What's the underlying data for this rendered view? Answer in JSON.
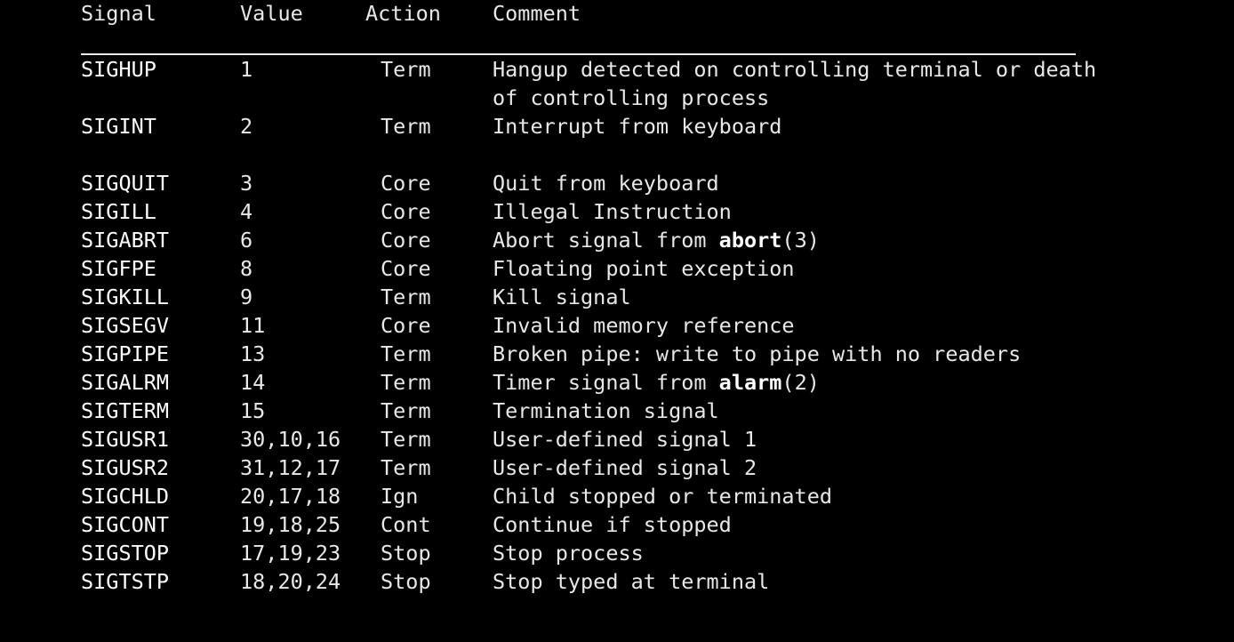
{
  "document": {
    "title": "signal(7) standard signals table",
    "background_color": "#000000",
    "text_color": "#e8e8e8",
    "accent_color": "#ffffff"
  },
  "table": {
    "headers": {
      "signal": "Signal",
      "value": "Value",
      "action": "Action",
      "comment": "Comment"
    },
    "rows": [
      {
        "signal": "SIGHUP",
        "value": "1",
        "action": "Term",
        "comment_pre": "Hangup detected on controlling terminal or death of controlling process",
        "comment_bold": "",
        "comment_post": ""
      },
      {
        "signal": "SIGINT",
        "value": "2",
        "action": "Term",
        "comment_pre": "Interrupt from keyboard",
        "comment_bold": "",
        "comment_post": ""
      },
      {
        "signal": "SIGQUIT",
        "value": "3",
        "action": "Core",
        "comment_pre": "Quit from keyboard",
        "comment_bold": "",
        "comment_post": ""
      },
      {
        "signal": "SIGILL",
        "value": "4",
        "action": "Core",
        "comment_pre": "Illegal Instruction",
        "comment_bold": "",
        "comment_post": ""
      },
      {
        "signal": "SIGABRT",
        "value": "6",
        "action": "Core",
        "comment_pre": "Abort signal from ",
        "comment_bold": "abort",
        "comment_post": "(3)"
      },
      {
        "signal": "SIGFPE",
        "value": "8",
        "action": "Core",
        "comment_pre": "Floating point exception",
        "comment_bold": "",
        "comment_post": ""
      },
      {
        "signal": "SIGKILL",
        "value": "9",
        "action": "Term",
        "comment_pre": "Kill signal",
        "comment_bold": "",
        "comment_post": ""
      },
      {
        "signal": "SIGSEGV",
        "value": "11",
        "action": "Core",
        "comment_pre": "Invalid memory reference",
        "comment_bold": "",
        "comment_post": ""
      },
      {
        "signal": "SIGPIPE",
        "value": "13",
        "action": "Term",
        "comment_pre": "Broken pipe: write to pipe with no readers",
        "comment_bold": "",
        "comment_post": ""
      },
      {
        "signal": "SIGALRM",
        "value": "14",
        "action": "Term",
        "comment_pre": "Timer signal from ",
        "comment_bold": "alarm",
        "comment_post": "(2)"
      },
      {
        "signal": "SIGTERM",
        "value": "15",
        "action": "Term",
        "comment_pre": "Termination signal",
        "comment_bold": "",
        "comment_post": ""
      },
      {
        "signal": "SIGUSR1",
        "value": "30,10,16",
        "action": "Term",
        "comment_pre": "User-defined signal 1",
        "comment_bold": "",
        "comment_post": ""
      },
      {
        "signal": "SIGUSR2",
        "value": "31,12,17",
        "action": "Term",
        "comment_pre": "User-defined signal 2",
        "comment_bold": "",
        "comment_post": ""
      },
      {
        "signal": "SIGCHLD",
        "value": "20,17,18",
        "action": "Ign",
        "comment_pre": "Child stopped or terminated",
        "comment_bold": "",
        "comment_post": ""
      },
      {
        "signal": "SIGCONT",
        "value": "19,18,25",
        "action": "Cont",
        "comment_pre": "Continue if stopped",
        "comment_bold": "",
        "comment_post": ""
      },
      {
        "signal": "SIGSTOP",
        "value": "17,19,23",
        "action": "Stop",
        "comment_pre": "Stop process",
        "comment_bold": "",
        "comment_post": ""
      },
      {
        "signal": "SIGTSTP",
        "value": "18,20,24",
        "action": "Stop",
        "comment_pre": "Stop typed at terminal",
        "comment_bold": "",
        "comment_post": ""
      }
    ]
  }
}
